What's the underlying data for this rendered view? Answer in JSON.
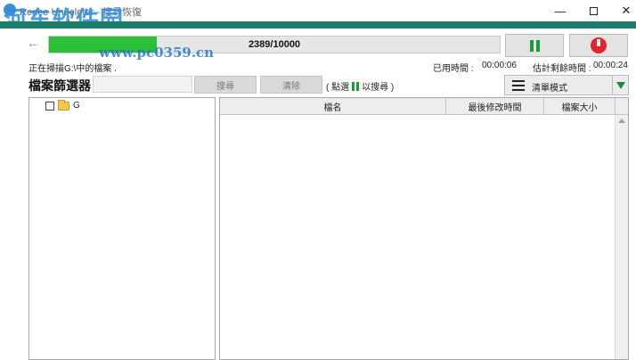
{
  "window": {
    "title": "Renee Undeleter - 搜尋恢復",
    "watermark_main": "河东软件园",
    "watermark_url": "www.pc0359.cn",
    "minimize_glyph": "—",
    "close_glyph": "✕"
  },
  "scan": {
    "progress_text": "2389/10000",
    "progress_fraction": 0.2389,
    "status_text": "正在掃描G:\\中的檔案 .",
    "elapsed_label": "已用時間 :",
    "elapsed_value": "00:00:06",
    "remaining_label": "估計剩餘時間 :",
    "remaining_value": "00:00:24",
    "pause_icon": "pause-icon",
    "stop_icon": "stop-icon"
  },
  "filter": {
    "label": "檔案篩選器",
    "input_value": "",
    "search_label": "搜尋",
    "clear_label": "清除",
    "hint_before": "( 點選",
    "hint_after": "以搜尋 )"
  },
  "view": {
    "mode_label": "清單模式",
    "icon": "list-icon"
  },
  "tree": {
    "items": [
      {
        "label": "G",
        "checked": false,
        "icon": "folder-icon"
      }
    ]
  },
  "table": {
    "columns": [
      "檔名",
      "最後修改時間",
      "檔案大小"
    ]
  },
  "colors": {
    "accent": "#1e7e6e",
    "progress": "#2bbf3a",
    "pause": "#1f9a3a",
    "stop": "#e0242a"
  }
}
